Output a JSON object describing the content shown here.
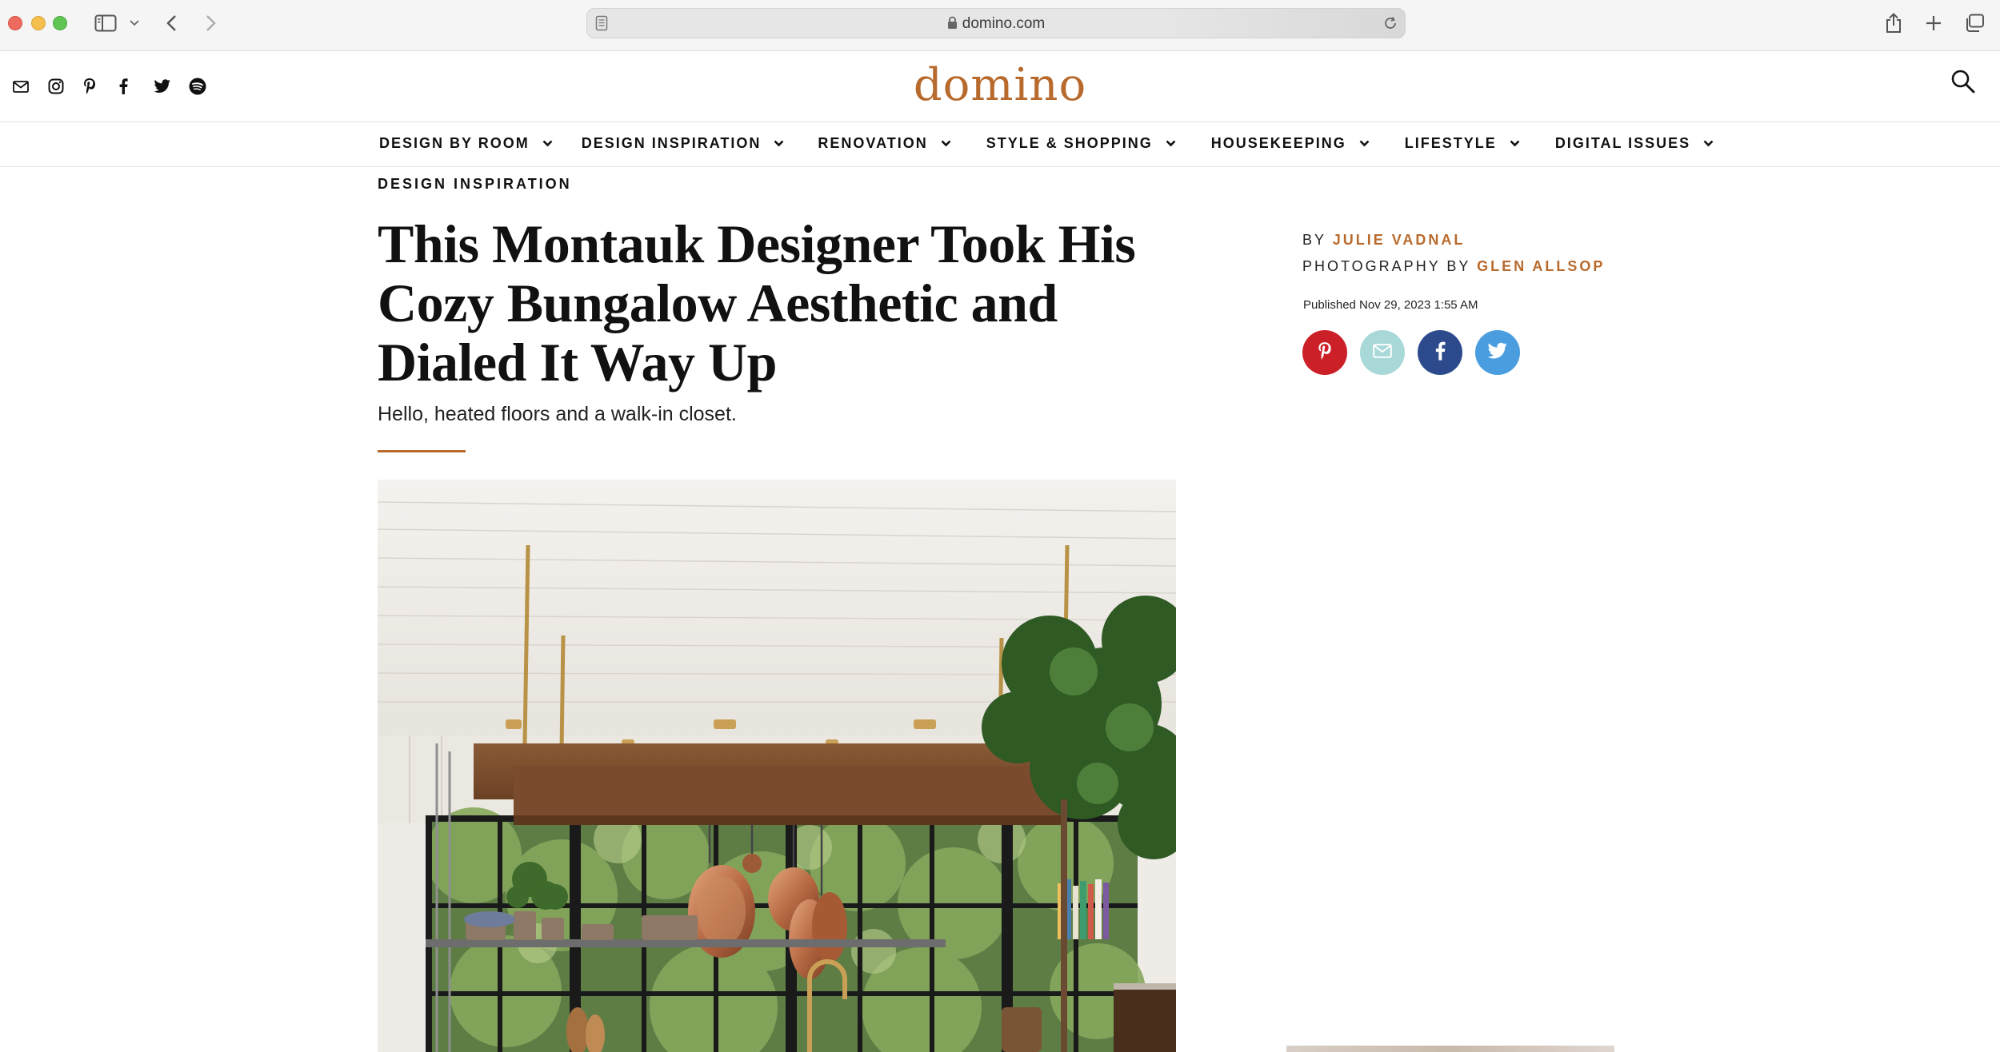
{
  "browser": {
    "url": "domino.com",
    "icons": [
      "sidebar-icon",
      "chevron-down-icon",
      "back-icon",
      "forward-icon",
      "page-icon",
      "lock-icon",
      "reload-icon",
      "share-icon",
      "plus-icon",
      "tabs-icon"
    ]
  },
  "header": {
    "logo": "domino",
    "social_icons": [
      "mail-icon",
      "instagram-icon",
      "pinterest-icon",
      "facebook-icon",
      "twitter-icon",
      "spotify-icon"
    ],
    "search_icon": "search-icon"
  },
  "nav": {
    "items": [
      {
        "label": "DESIGN BY ROOM"
      },
      {
        "label": "DESIGN INSPIRATION"
      },
      {
        "label": "RENOVATION"
      },
      {
        "label": "STYLE & SHOPPING"
      },
      {
        "label": "HOUSEKEEPING"
      },
      {
        "label": "LIFESTYLE"
      },
      {
        "label": "DIGITAL ISSUES"
      }
    ]
  },
  "article": {
    "kicker": "DESIGN INSPIRATION",
    "title": "This Montauk Designer Took His Cozy Bungalow Aesthetic and Dialed It Way Up",
    "dek": "Hello, heated floors and a walk-in closet.",
    "by_prefix": "BY",
    "author": "JULIE VADNAL",
    "photo_prefix": "PHOTOGRAPHY BY",
    "photographer": "GLEN ALLSOP",
    "published": "Published Nov 29, 2023 1:55 AM",
    "share": [
      {
        "icon": "pinterest-icon",
        "color": "#cb2027"
      },
      {
        "icon": "mail-icon",
        "color": "#a8d8d8"
      },
      {
        "icon": "facebook-icon",
        "color": "#2d4b8c"
      },
      {
        "icon": "twitter-icon",
        "color": "#4a9ee0"
      }
    ]
  },
  "colors": {
    "accent": "#b86a2d"
  }
}
